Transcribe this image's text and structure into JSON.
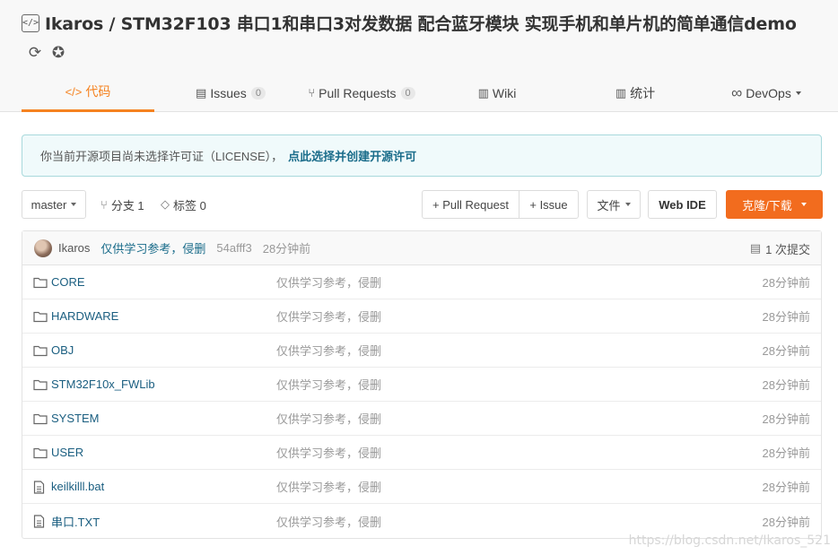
{
  "header": {
    "title": "Ikaros / STM32F103 串口1和串口3对发数据 配合蓝牙模块 实现手机和单片机的简单通信demo",
    "icons": [
      "code-icon",
      "sync-icon",
      "award-icon"
    ]
  },
  "tabs": [
    {
      "label": "代码",
      "icon": "code-icon"
    },
    {
      "label": "Issues",
      "icon": "issues-icon",
      "count": "0"
    },
    {
      "label": "Pull Requests",
      "icon": "pull-request-icon",
      "count": "0"
    },
    {
      "label": "Wiki",
      "icon": "wiki-icon"
    },
    {
      "label": "统计",
      "icon": "stats-icon"
    },
    {
      "label": "DevOps",
      "icon": "infinity-icon"
    }
  ],
  "notice": {
    "text": "你当前开源项目尚未选择许可证（LICENSE），",
    "link": "点此选择并创建开源许可"
  },
  "toolbar": {
    "branch": "master",
    "branches": "分支 1",
    "tags": "标签 0",
    "pull_request": "+ Pull Request",
    "issue": "+ Issue",
    "files": "文件",
    "web_ide": "Web IDE",
    "clone": "克隆/下载"
  },
  "commit": {
    "author": "Ikaros",
    "message": "仅供学习参考，侵删",
    "sha": "54afff3",
    "time": "28分钟前",
    "count": "1 次提交"
  },
  "files": [
    {
      "name": "CORE",
      "type": "folder",
      "message": "仅供学习参考，侵删",
      "time": "28分钟前"
    },
    {
      "name": "HARDWARE",
      "type": "folder",
      "message": "仅供学习参考，侵删",
      "time": "28分钟前"
    },
    {
      "name": "OBJ",
      "type": "folder",
      "message": "仅供学习参考，侵删",
      "time": "28分钟前"
    },
    {
      "name": "STM32F10x_FWLib",
      "type": "folder",
      "message": "仅供学习参考，侵删",
      "time": "28分钟前"
    },
    {
      "name": "SYSTEM",
      "type": "folder",
      "message": "仅供学习参考，侵删",
      "time": "28分钟前"
    },
    {
      "name": "USER",
      "type": "folder",
      "message": "仅供学习参考，侵删",
      "time": "28分钟前"
    },
    {
      "name": "keilkilll.bat",
      "type": "file",
      "message": "仅供学习参考，侵删",
      "time": "28分钟前"
    },
    {
      "name": "串口.TXT",
      "type": "file",
      "message": "仅供学习参考，侵删",
      "time": "28分钟前"
    }
  ],
  "watermark": "https://blog.csdn.net/Ikaros_521",
  "colors": {
    "accent": "#f58220",
    "clone_button": "#f26c1e",
    "link": "#1a5e80",
    "notice_bg": "#f0fafb"
  }
}
